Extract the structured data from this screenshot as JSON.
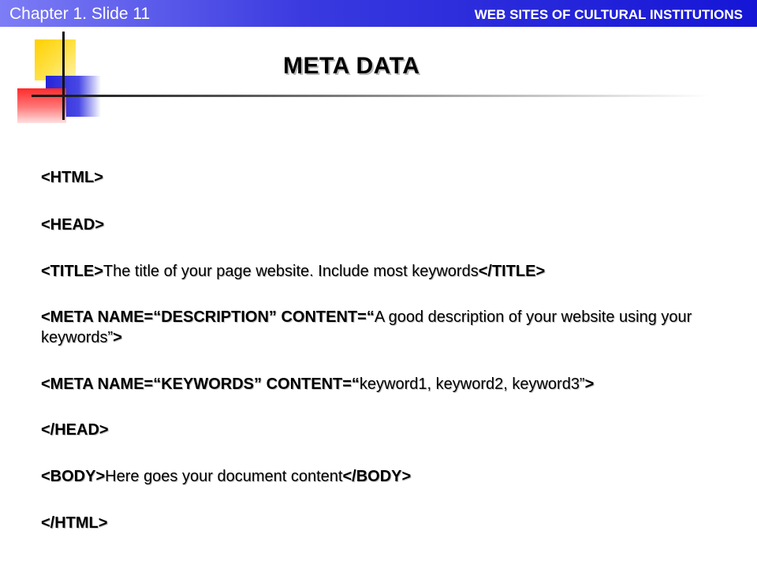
{
  "header": {
    "chapter": "Chapter 1. Slide 11",
    "section": "WEB SITES OF CULTURAL INSTITUTIONS"
  },
  "slide": {
    "title": "META DATA"
  },
  "code_lines": [
    {
      "tag_open": "<HTML>"
    },
    {
      "tag_open": "<HEAD>"
    },
    {
      "tag_open": "<TITLE>",
      "text": "The title of your page website. Include most keywords",
      "tag_close": "</TITLE>"
    },
    {
      "tag_open": "<META NAME=“DESCRIPTION” CONTENT=“",
      "text": "A good description of your website using your keywords”",
      "tag_close": ">"
    },
    {
      "tag_open": "<META NAME=“KEYWORDS” CONTENT=“",
      "text": "keyword1, keyword2, keyword3”",
      "tag_close": ">"
    },
    {
      "tag_open": "</HEAD>"
    },
    {
      "tag_open": "<BODY>",
      "text": "Here goes your document content",
      "tag_close": "</BODY>"
    },
    {
      "tag_open": "</HTML>"
    }
  ]
}
